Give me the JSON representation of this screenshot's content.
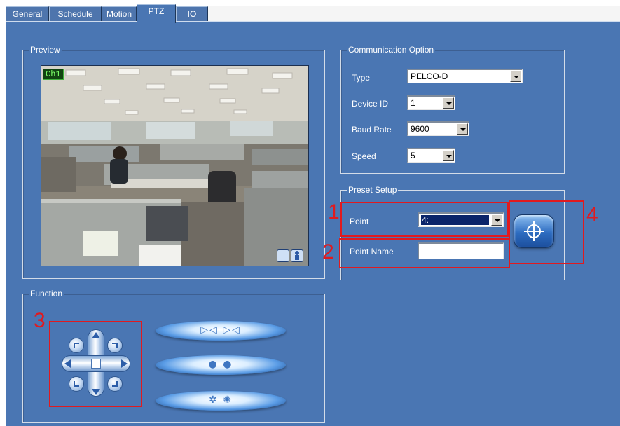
{
  "tabs": [
    "General",
    "Schedule",
    "Motion",
    "PTZ",
    "IO"
  ],
  "active_tab": "PTZ",
  "preview": {
    "title": "Preview",
    "channel_label": "Ch1"
  },
  "communication": {
    "title": "Communication Option",
    "type_label": "Type",
    "type_value": "PELCO-D",
    "device_id_label": "Device ID",
    "device_id_value": "1",
    "baud_rate_label": "Baud Rate",
    "baud_rate_value": "9600",
    "speed_label": "Speed",
    "speed_value": "5"
  },
  "preset": {
    "title": "Preset Setup",
    "point_label": "Point",
    "point_value": "4:",
    "point_name_label": "Point Name",
    "point_name_value": ""
  },
  "function": {
    "title": "Function"
  },
  "annotations": {
    "n1": "1",
    "n2": "2",
    "n3": "3",
    "n4": "4"
  },
  "colors": {
    "panel_bg": "#4a76b3",
    "annotation_red": "#e01a1f"
  },
  "icons": {
    "set_preset": "crosshair-icon",
    "zoom": "zoom-arrows-icon",
    "focus": "focus-dots-icon",
    "iris": "iris-icon"
  }
}
